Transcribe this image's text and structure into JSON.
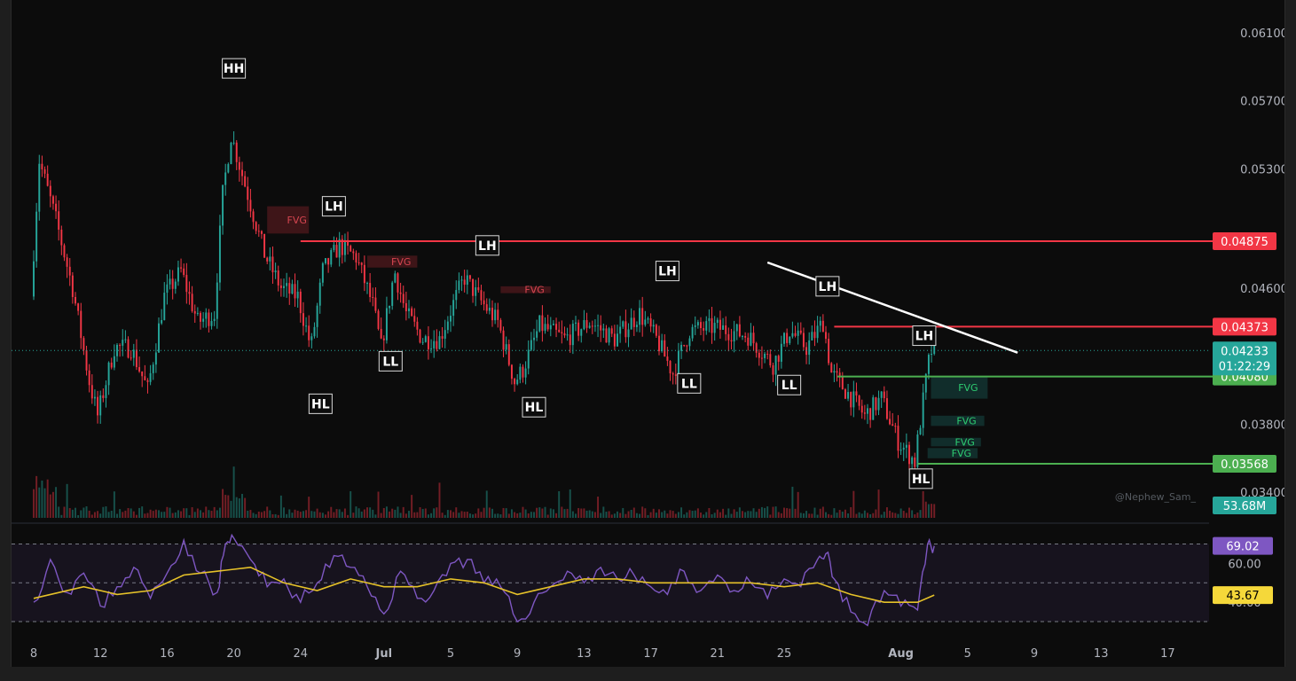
{
  "watermark": "@Nephew_Sam_",
  "chart_data": {
    "type": "candlestick",
    "y_axis": {
      "ticks": [
        "0.06100",
        "0.05700",
        "0.05300",
        "0.04600",
        "0.03800",
        "0.03400"
      ],
      "tick_values": [
        0.061,
        0.057,
        0.053,
        0.046,
        0.038,
        0.034
      ],
      "range": [
        0.0325,
        0.0625
      ]
    },
    "x_axis": {
      "ticks": [
        "8",
        "12",
        "16",
        "20",
        "24",
        "Jul",
        "5",
        "9",
        "13",
        "17",
        "21",
        "25",
        "Aug",
        "5",
        "9",
        "13",
        "17"
      ],
      "tick_day_index": [
        0,
        4,
        8,
        12,
        16,
        21,
        25,
        29,
        33,
        37,
        41,
        45,
        52,
        56,
        60,
        64,
        68
      ]
    },
    "price_path": [
      [
        0,
        0.0455
      ],
      [
        0.5,
        0.0535
      ],
      [
        1.5,
        0.05
      ],
      [
        2.5,
        0.046
      ],
      [
        3.5,
        0.0405
      ],
      [
        4,
        0.0385
      ],
      [
        5,
        0.0425
      ],
      [
        6,
        0.0425
      ],
      [
        7,
        0.04
      ],
      [
        8,
        0.0455
      ],
      [
        9,
        0.047
      ],
      [
        10,
        0.044
      ],
      [
        11,
        0.0445
      ],
      [
        11.5,
        0.0515
      ],
      [
        12,
        0.055
      ],
      [
        13,
        0.0515
      ],
      [
        14,
        0.048
      ],
      [
        15,
        0.046
      ],
      [
        16,
        0.0455
      ],
      [
        16.8,
        0.0425
      ],
      [
        17.5,
        0.047
      ],
      [
        18.5,
        0.0485
      ],
      [
        19.5,
        0.0478
      ],
      [
        20.5,
        0.045
      ],
      [
        21,
        0.0425
      ],
      [
        21.8,
        0.047
      ],
      [
        22.5,
        0.0445
      ],
      [
        23.5,
        0.043
      ],
      [
        24.5,
        0.043
      ],
      [
        25.5,
        0.0455
      ],
      [
        26,
        0.0466
      ],
      [
        27,
        0.0452
      ],
      [
        28,
        0.044
      ],
      [
        29,
        0.0405
      ],
      [
        29.5,
        0.0412
      ],
      [
        30.5,
        0.0438
      ],
      [
        32,
        0.043
      ],
      [
        33.5,
        0.044
      ],
      [
        35,
        0.043
      ],
      [
        36.5,
        0.0445
      ],
      [
        37.5,
        0.043
      ],
      [
        38.5,
        0.041
      ],
      [
        39.5,
        0.0435
      ],
      [
        41,
        0.0437
      ],
      [
        43,
        0.0432
      ],
      [
        44.5,
        0.0415
      ],
      [
        45.5,
        0.0435
      ],
      [
        46.5,
        0.0425
      ],
      [
        47.5,
        0.044
      ],
      [
        48,
        0.041
      ],
      [
        49,
        0.0398
      ],
      [
        50,
        0.0385
      ],
      [
        51,
        0.0395
      ],
      [
        52,
        0.037
      ],
      [
        53,
        0.0358
      ],
      [
        53.8,
        0.0415
      ],
      [
        54,
        0.0423
      ]
    ],
    "volume_peak": [
      0,
      12,
      52
    ],
    "volume_label": "53.68M",
    "levels": [
      {
        "price": 0.04875,
        "label": "0.04875",
        "color": "#f23645",
        "from_day": 16
      },
      {
        "price": 0.04373,
        "label": "0.04373",
        "color": "#f23645",
        "from_day": 48
      },
      {
        "price": 0.0408,
        "label": "0.04080",
        "color": "#4caf50",
        "from_day": 48.2
      },
      {
        "price": 0.03568,
        "label": "0.03568",
        "color": "#4caf50",
        "from_day": 53
      }
    ],
    "current_price": {
      "label": "0.04233",
      "countdown": "01:22:29",
      "price": 0.04233
    },
    "trendline": [
      [
        44,
        0.0475
      ],
      [
        59,
        0.0422
      ]
    ],
    "swing_labels": [
      {
        "text": "HH",
        "day": 12,
        "price": 0.0589,
        "pos": "above"
      },
      {
        "text": "LH",
        "day": 18,
        "price": 0.0508,
        "pos": "above"
      },
      {
        "text": "HL",
        "day": 17.2,
        "price": 0.0392,
        "pos": "below"
      },
      {
        "text": "LL",
        "day": 21.4,
        "price": 0.0417,
        "pos": "below"
      },
      {
        "text": "LH",
        "day": 27.2,
        "price": 0.0485,
        "pos": "above"
      },
      {
        "text": "HL",
        "day": 30,
        "price": 0.039,
        "pos": "below"
      },
      {
        "text": "LH",
        "day": 38,
        "price": 0.047,
        "pos": "above"
      },
      {
        "text": "LL",
        "day": 39.3,
        "price": 0.0404,
        "pos": "below"
      },
      {
        "text": "LL",
        "day": 45.3,
        "price": 0.0403,
        "pos": "below"
      },
      {
        "text": "LH",
        "day": 47.6,
        "price": 0.0461,
        "pos": "above"
      },
      {
        "text": "LH",
        "day": 53.4,
        "price": 0.0432,
        "pos": "above"
      },
      {
        "text": "HL",
        "day": 53.2,
        "price": 0.0348,
        "pos": "below"
      }
    ],
    "fvg_zones": [
      {
        "label": "FVG",
        "color": "red",
        "from_day": 14,
        "to_day": 16.5,
        "top": 0.0508,
        "bottom": 0.0492
      },
      {
        "label": "FVG",
        "color": "red",
        "from_day": 20,
        "to_day": 23,
        "top": 0.0479,
        "bottom": 0.0472
      },
      {
        "label": "FVG",
        "color": "red",
        "from_day": 28,
        "to_day": 31,
        "top": 0.0461,
        "bottom": 0.0457
      },
      {
        "label": "FVG",
        "color": "green",
        "from_day": 53.8,
        "to_day": 57.2,
        "top": 0.0408,
        "bottom": 0.0395
      },
      {
        "label": "FVG",
        "color": "green",
        "from_day": 53.8,
        "to_day": 57,
        "top": 0.0385,
        "bottom": 0.0379
      },
      {
        "label": "FVG",
        "color": "green",
        "from_day": 53.8,
        "to_day": 56.8,
        "top": 0.0372,
        "bottom": 0.0367
      },
      {
        "label": "FVG",
        "color": "green",
        "from_day": 53.6,
        "to_day": 56.6,
        "top": 0.0366,
        "bottom": 0.036
      }
    ],
    "rsi": {
      "ticks": [
        "60.00",
        "40.00"
      ],
      "tick_values": [
        60,
        40
      ],
      "range": [
        25,
        78
      ],
      "bands": [
        70,
        50,
        30
      ],
      "value_label": "69.02",
      "ma_label": "43.67",
      "path": [
        [
          0,
          40
        ],
        [
          1,
          62
        ],
        [
          2,
          45
        ],
        [
          3,
          55
        ],
        [
          4,
          38
        ],
        [
          5,
          48
        ],
        [
          6,
          58
        ],
        [
          7,
          42
        ],
        [
          8,
          55
        ],
        [
          9,
          72
        ],
        [
          10,
          55
        ],
        [
          11,
          45
        ],
        [
          11.5,
          70
        ],
        [
          12,
          73
        ],
        [
          13,
          62
        ],
        [
          14,
          48
        ],
        [
          15,
          52
        ],
        [
          16,
          40
        ],
        [
          17,
          50
        ],
        [
          18,
          64
        ],
        [
          19,
          58
        ],
        [
          20,
          48
        ],
        [
          21,
          34
        ],
        [
          22,
          56
        ],
        [
          23,
          42
        ],
        [
          24,
          46
        ],
        [
          25,
          60
        ],
        [
          26,
          62
        ],
        [
          27,
          50
        ],
        [
          28,
          48
        ],
        [
          29,
          30
        ],
        [
          30,
          40
        ],
        [
          31,
          48
        ],
        [
          32,
          56
        ],
        [
          33,
          50
        ],
        [
          34,
          58
        ],
        [
          35,
          52
        ],
        [
          36,
          54
        ],
        [
          37,
          48
        ],
        [
          38,
          44
        ],
        [
          39,
          56
        ],
        [
          40,
          46
        ],
        [
          41,
          54
        ],
        [
          42,
          46
        ],
        [
          43,
          50
        ],
        [
          44,
          42
        ],
        [
          45,
          52
        ],
        [
          46,
          48
        ],
        [
          47,
          62
        ],
        [
          47.5,
          65
        ],
        [
          48,
          52
        ],
        [
          49,
          35
        ],
        [
          50,
          28
        ],
        [
          51,
          46
        ],
        [
          52,
          38
        ],
        [
          53,
          36
        ],
        [
          53.6,
          70
        ],
        [
          54,
          69
        ]
      ],
      "ma_path": [
        [
          0,
          42
        ],
        [
          3,
          48
        ],
        [
          5,
          44
        ],
        [
          7,
          46
        ],
        [
          9,
          54
        ],
        [
          11,
          56
        ],
        [
          13,
          58
        ],
        [
          15,
          50
        ],
        [
          17,
          46
        ],
        [
          19,
          52
        ],
        [
          21,
          48
        ],
        [
          23,
          48
        ],
        [
          25,
          52
        ],
        [
          27,
          50
        ],
        [
          29,
          44
        ],
        [
          31,
          48
        ],
        [
          33,
          52
        ],
        [
          35,
          52
        ],
        [
          37,
          50
        ],
        [
          39,
          50
        ],
        [
          41,
          50
        ],
        [
          43,
          50
        ],
        [
          45,
          48
        ],
        [
          47,
          50
        ],
        [
          49,
          44
        ],
        [
          51,
          40
        ],
        [
          53,
          40
        ],
        [
          54,
          43.67
        ]
      ]
    }
  }
}
